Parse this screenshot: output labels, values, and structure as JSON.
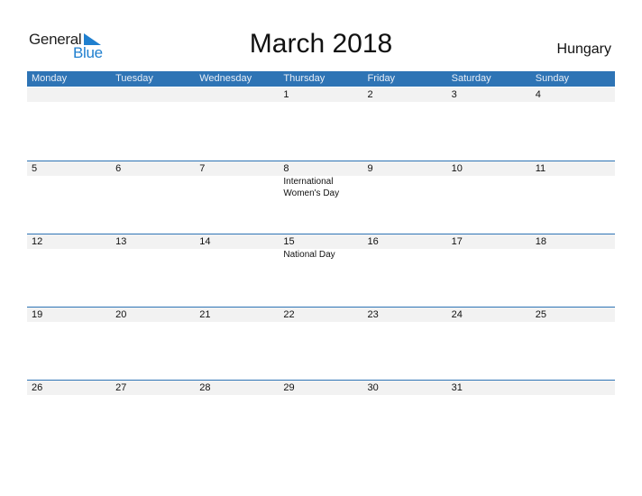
{
  "logo": {
    "word1": "General",
    "word2": "Blue",
    "accent": "#1f7fcf"
  },
  "title": "March 2018",
  "country": "Hungary",
  "colors": {
    "header_bg": "#2e74b5",
    "date_strip": "#f2f2f2"
  },
  "weekdays": [
    "Monday",
    "Tuesday",
    "Wednesday",
    "Thursday",
    "Friday",
    "Saturday",
    "Sunday"
  ],
  "weeks": [
    {
      "days": [
        "",
        "",
        "",
        "1",
        "2",
        "3",
        "4"
      ],
      "events": [
        "",
        "",
        "",
        "",
        "",
        "",
        ""
      ]
    },
    {
      "days": [
        "5",
        "6",
        "7",
        "8",
        "9",
        "10",
        "11"
      ],
      "events": [
        "",
        "",
        "",
        "International Women's Day",
        "",
        "",
        ""
      ]
    },
    {
      "days": [
        "12",
        "13",
        "14",
        "15",
        "16",
        "17",
        "18"
      ],
      "events": [
        "",
        "",
        "",
        "National Day",
        "",
        "",
        ""
      ]
    },
    {
      "days": [
        "19",
        "20",
        "21",
        "22",
        "23",
        "24",
        "25"
      ],
      "events": [
        "",
        "",
        "",
        "",
        "",
        "",
        ""
      ]
    },
    {
      "days": [
        "26",
        "27",
        "28",
        "29",
        "30",
        "31",
        ""
      ],
      "events": [
        "",
        "",
        "",
        "",
        "",
        "",
        ""
      ]
    }
  ]
}
